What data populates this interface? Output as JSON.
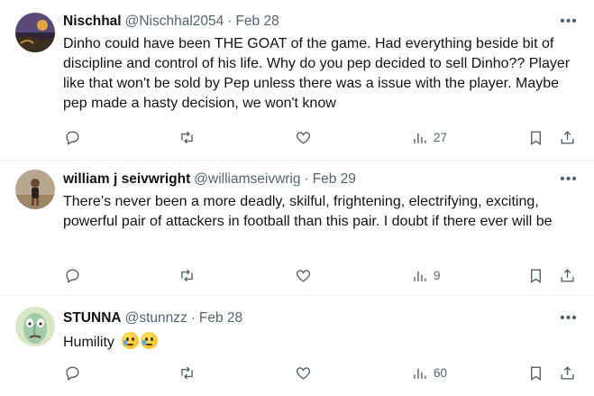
{
  "tweets": [
    {
      "name": "Nischhal",
      "handle": "@Nischhal2054",
      "separator": "·",
      "date": "Feb 28",
      "text": "Dinho could have been THE GOAT of the game. Had everything beside bit of discipline and control of his life. Why do you pep decided to sell Dinho?? Player like that won't be sold by Pep unless there was a issue with the player. Maybe pep made a hasty decision, we won't know",
      "views": "27",
      "more_icon": "more-dots-icon"
    },
    {
      "name": "william j seivwright",
      "handle": "@williamseivwrig",
      "separator": "·",
      "date": "Feb 29",
      "text": "There’s never been a more deadly, skilful, frightening, electrifying, exciting, powerful pair of attackers in football than this pair. I doubt if there ever will be",
      "views": "9",
      "more_icon": "more-dots-icon"
    },
    {
      "name": "STUNNA",
      "handle": "@stunnzz",
      "separator": "·",
      "date": "Feb 28",
      "text": "Humility",
      "emojis": [
        "face-holding-back-tears",
        "face-holding-back-tears"
      ],
      "views": "60",
      "more_icon": "more-dots-icon"
    }
  ],
  "icons": {
    "reply": "reply-icon",
    "retweet": "retweet-icon",
    "like": "like-icon",
    "views": "views-icon",
    "bookmark": "bookmark-icon",
    "share": "share-icon"
  },
  "colors": {
    "text_primary": "#0f1419",
    "text_secondary": "#536471",
    "divider": "#eff3f4"
  }
}
